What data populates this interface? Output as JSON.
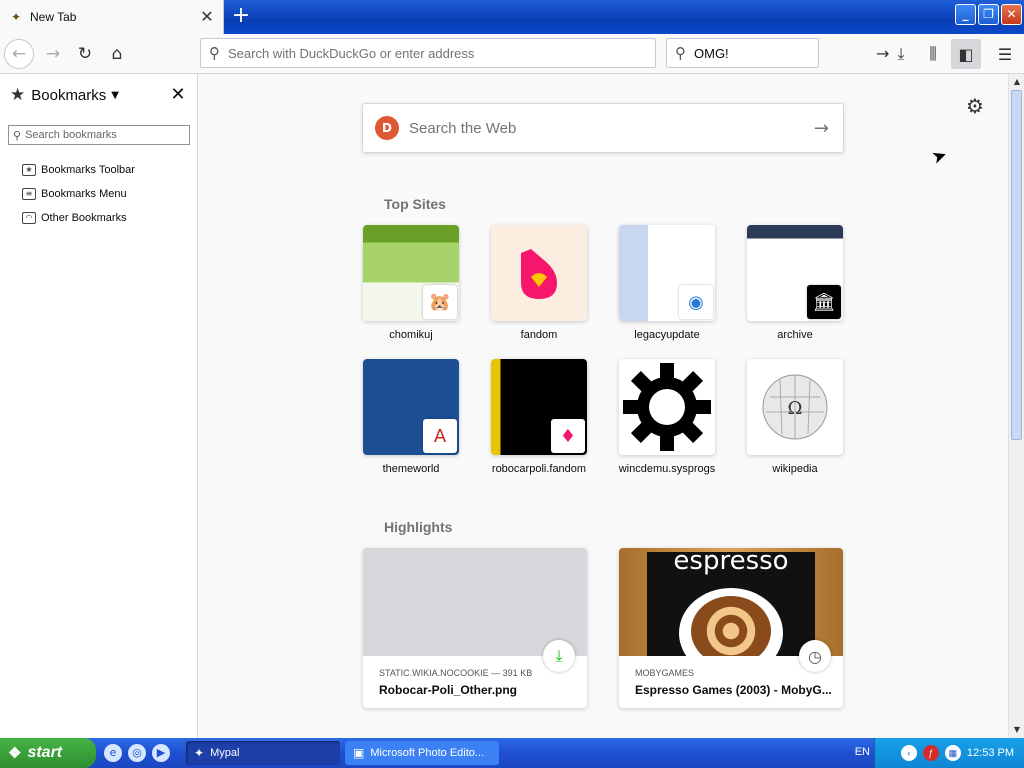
{
  "tab": {
    "title": "New Tab",
    "close": "✕",
    "new_tab": "+"
  },
  "window_buttons": {
    "minimize": "_",
    "restore": "❐",
    "close": "✕"
  },
  "urlbar": {
    "placeholder": "Search with DuckDuckGo or enter address",
    "value": ""
  },
  "searchbar": {
    "value": "OMG!"
  },
  "sidebar": {
    "title": "Bookmarks",
    "search_placeholder": "Search bookmarks",
    "items": [
      {
        "label": "Bookmarks Toolbar",
        "icon": "bookmarks-toolbar-icon"
      },
      {
        "label": "Bookmarks Menu",
        "icon": "bookmarks-menu-icon"
      },
      {
        "label": "Other Bookmarks",
        "icon": "other-bookmarks-icon"
      }
    ]
  },
  "newtab": {
    "search_placeholder": "Search the Web",
    "top_sites_title": "Top Sites",
    "top_sites": [
      {
        "label": "chomikuj",
        "color": "#8bc34a"
      },
      {
        "label": "fandom",
        "color": "#fbeee0"
      },
      {
        "label": "legacyupdate",
        "color": "#dbe6f7"
      },
      {
        "label": "archive",
        "color": "#ffffff"
      },
      {
        "label": "themeworld",
        "color": "#1d4f94"
      },
      {
        "label": "robocarpoli.fandom",
        "color": "#000000"
      },
      {
        "label": "wincdemu.sysprogs",
        "color": "#ffffff"
      },
      {
        "label": "wikipedia",
        "color": "#ffffff"
      }
    ],
    "highlights_title": "Highlights",
    "highlights": [
      {
        "source": "STATIC.WIKIA.NOCOOKIE — 391 KB",
        "title": "Robocar-Poli_Other.png",
        "badge": "download-icon"
      },
      {
        "source": "MOBYGAMES",
        "title": "Espresso Games (2003) - MobyG...",
        "badge": "clock-icon",
        "image_text": "espresso"
      }
    ]
  },
  "taskbar": {
    "start": "start",
    "items": [
      {
        "label": "Mypal"
      },
      {
        "label": "Microsoft Photo Edito..."
      }
    ],
    "lang": "EN",
    "time": "12:53 PM"
  }
}
